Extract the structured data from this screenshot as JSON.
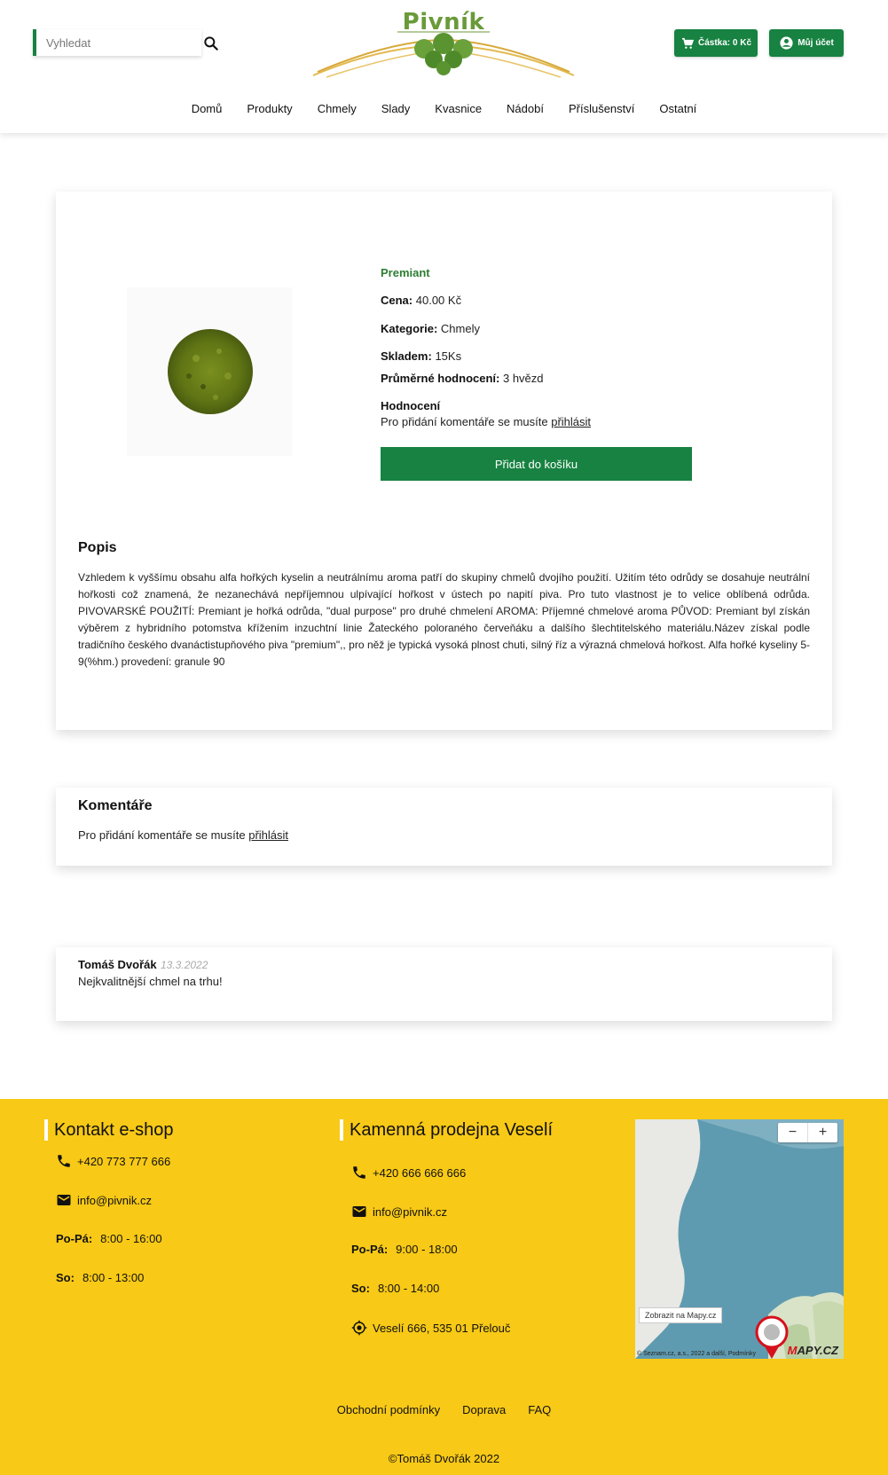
{
  "header": {
    "search_placeholder": "Vyhledat",
    "logo_text": "Pivník",
    "cart_label": "Částka: 0 Kč",
    "account_label": "Můj účet"
  },
  "nav": {
    "items": [
      {
        "label": "Domů"
      },
      {
        "label": "Produkty"
      },
      {
        "label": "Chmely"
      },
      {
        "label": "Slady"
      },
      {
        "label": "Kvasnice"
      },
      {
        "label": "Nádobí"
      },
      {
        "label": "Příslušenství"
      },
      {
        "label": "Ostatní"
      }
    ]
  },
  "product": {
    "name": "Premiant",
    "price_label": "Cena:",
    "price": "40.00 Kč",
    "category_label": "Kategorie:",
    "category": "Chmely",
    "stock_label": "Skladem:",
    "stock": "15Ks",
    "rating_label": "Průměrné hodnocení:",
    "rating": "3 hvězd",
    "review_heading": "Hodnocení",
    "login_prompt": "Pro přidání komentáře se musíte",
    "login_link": "přihlásit",
    "add_to_cart": "Přidat do košíku",
    "description_title": "Popis",
    "description": "Vzhledem k vyššímu obsahu alfa hořkých kyselin a neutrálnímu aroma patří do skupiny chmelů dvojího použití. Užitím této odrůdy se dosahuje neutrální hořkosti což znamená, že nezanechává nepříjemnou ulpívající hořkost v ústech po napití piva. Pro tuto vlastnost je to velice oblíbená odrůda. PIVOVARSKÉ POUŽITÍ: Premiant je hořká odrůda, \"dual purpose\" pro druhé chmelení AROMA: Příjemné chmelové aroma PŮVOD: Premiant byl získán výběrem z hybridního potomstva křížením inzuchtní linie Žateckého poloraného červeňáku a dalšího šlechtitelského materiálu.Název získal podle tradičního českého dvanáctistupňového piva \"premium\",, pro něž je typická vysoká plnost chuti, silný říz a výrazná chmelová hořkost. Alfa hořké kyseliny 5-9(%hm.) provedení: granule 90"
  },
  "comments": {
    "title": "Komentáře",
    "login_prompt": "Pro přidání komentáře se musíte",
    "login_link": "přihlásit"
  },
  "review": {
    "author": "Tomáš Dvořák",
    "date": "13.3.2022",
    "text": "Nejkvalitnější chmel na trhu!"
  },
  "footer": {
    "eshop": {
      "title": "Kontakt e-shop",
      "phone": "+420 773 777 666",
      "email": "info@pivnik.cz",
      "weekday_label": "Po-Pá:",
      "weekday_hours": "8:00 - 16:00",
      "sat_label": "So:",
      "sat_hours": "8:00 - 13:00"
    },
    "store": {
      "title": "Kamenná prodejna Veselí",
      "phone": "+420 666 666 666",
      "email": "info@pivnik.cz",
      "weekday_label": "Po-Pá:",
      "weekday_hours": "9:00 - 18:00",
      "sat_label": "So:",
      "sat_hours": "8:00 - 14:00",
      "address": "Veselí 666, 535 01 Přelouč"
    },
    "map": {
      "show_label": "Zobrazit na Mapy.cz",
      "zoom_out": "−",
      "zoom_in": "+",
      "copyright": "© Seznam.cz, a.s., 2022 a další, Podmínky",
      "logo_a": "M",
      "logo_b": "APY.CZ"
    },
    "links": [
      {
        "label": "Obchodní podmínky"
      },
      {
        "label": "Doprava"
      },
      {
        "label": "FAQ"
      }
    ],
    "copyright": "©Tomáš Dvořák 2022"
  },
  "colors": {
    "primary_green": "#178241",
    "footer_yellow": "#f8c916",
    "product_name_green": "#2e7d32"
  }
}
